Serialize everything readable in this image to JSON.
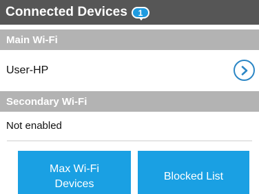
{
  "header": {
    "title": "Connected Devices",
    "badge_count": "1"
  },
  "sections": {
    "main": {
      "title": "Main Wi-Fi",
      "devices": [
        {
          "name": "User-HP",
          "action_icon": "chevron-right-icon"
        }
      ]
    },
    "secondary": {
      "title": "Secondary Wi-Fi",
      "status": "Not enabled"
    }
  },
  "buttons": {
    "max_wifi_devices": "Max Wi-Fi\nDevices",
    "blocked_list": "Blocked List"
  },
  "colors": {
    "header_bg": "#565656",
    "section_bg": "#b3b3b3",
    "accent": "#1aa0e3",
    "badge": "#1f9be0",
    "chevron": "#2b86c5"
  }
}
